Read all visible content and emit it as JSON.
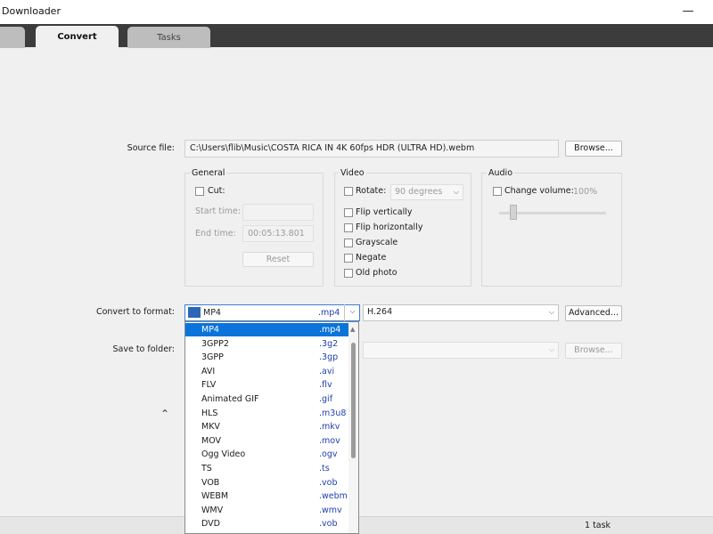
{
  "window": {
    "title": "Downloader",
    "minimize": "—"
  },
  "tabs": [
    {
      "label": ""
    },
    {
      "label": "Convert"
    },
    {
      "label": "Tasks"
    }
  ],
  "source": {
    "label": "Source file:",
    "value": "C:\\Users\\flib\\Music\\COSTA RICA IN 4K 60fps HDR (ULTRA HD).webm",
    "browse_label": "Browse..."
  },
  "general": {
    "title": "General",
    "cut_label": "Cut:",
    "start_label": "Start time:",
    "start_value": "",
    "end_label": "End time:",
    "end_value": "00:05:13.801",
    "reset_label": "Reset"
  },
  "video": {
    "title": "Video",
    "rotate_label": "Rotate:",
    "rotate_value": "90 degrees",
    "flip_vertical": "Flip vertically",
    "flip_horizontal": "Flip horizontally",
    "grayscale": "Grayscale",
    "negate": "Negate",
    "old_photo": "Old photo"
  },
  "audio": {
    "title": "Audio",
    "change_volume_label": "Change volume:",
    "volume_value": "100%",
    "volume_level": 0.13
  },
  "convert": {
    "label": "Convert to format:",
    "selected_name": "MP4",
    "selected_ext": ".mp4",
    "codec": "H.264",
    "advanced_label": "Advanced..."
  },
  "save": {
    "label": "Save to folder:",
    "browse_label": "Browse..."
  },
  "format_options": [
    {
      "name": "MP4",
      "ext": ".mp4"
    },
    {
      "name": "3GPP2",
      "ext": ".3g2"
    },
    {
      "name": "3GPP",
      "ext": ".3gp"
    },
    {
      "name": "AVI",
      "ext": ".avi"
    },
    {
      "name": "FLV",
      "ext": ".flv"
    },
    {
      "name": "Animated GIF",
      "ext": ".gif"
    },
    {
      "name": "HLS",
      "ext": ".m3u8"
    },
    {
      "name": "MKV",
      "ext": ".mkv"
    },
    {
      "name": "MOV",
      "ext": ".mov"
    },
    {
      "name": "Ogg Video",
      "ext": ".ogv"
    },
    {
      "name": "TS",
      "ext": ".ts"
    },
    {
      "name": "VOB",
      "ext": ".vob"
    },
    {
      "name": "WEBM",
      "ext": ".webm"
    },
    {
      "name": "WMV",
      "ext": ".wmv"
    },
    {
      "name": "DVD",
      "ext": ".vob"
    }
  ],
  "status": {
    "text": "1 task"
  },
  "colors": {
    "selection": "#0a74da",
    "extension": "#1f3fb0",
    "tabbar": "#3c3c3c"
  }
}
